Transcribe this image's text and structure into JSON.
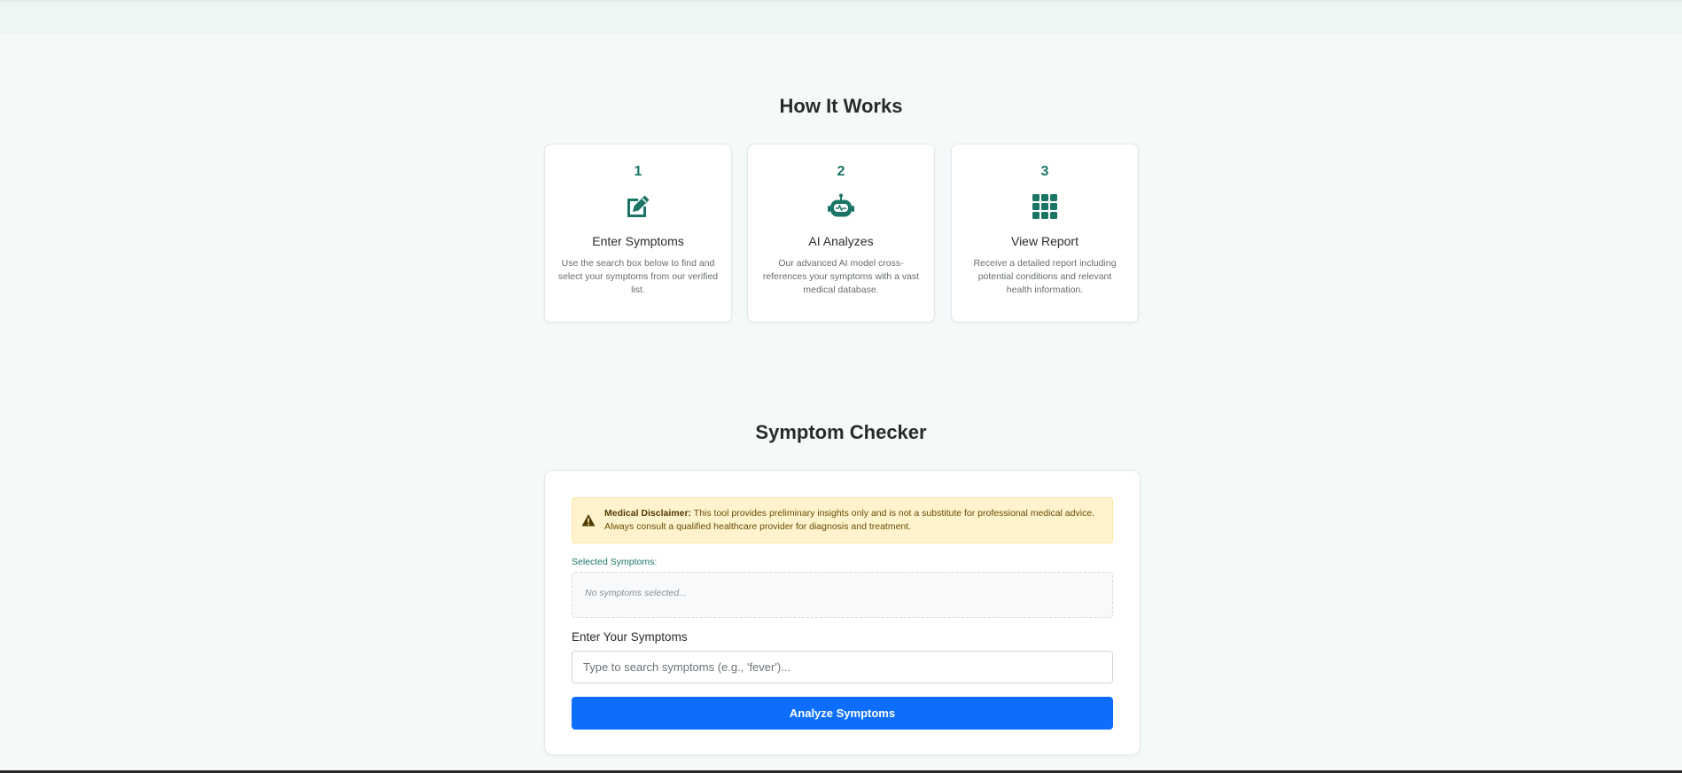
{
  "colors": {
    "accent": "#1a7566",
    "primary_button": "#0d6efd",
    "warning_bg": "#fff3cd",
    "warning_text": "#664d03"
  },
  "how_it_works": {
    "title": "How It Works",
    "steps": [
      {
        "number": "1",
        "icon": "edit-icon",
        "title": "Enter Symptoms",
        "description": "Use the search box below to find and select your symptoms from our verified list."
      },
      {
        "number": "2",
        "icon": "robot-icon",
        "title": "AI Analyzes",
        "description": "Our advanced AI model cross-references your symptoms with a vast medical database."
      },
      {
        "number": "3",
        "icon": "grid-icon",
        "title": "View Report",
        "description": "Receive a detailed report including potential conditions and relevant health information."
      }
    ]
  },
  "checker": {
    "title": "Symptom Checker",
    "disclaimer": {
      "icon": "warning-icon",
      "label": "Medical Disclaimer:",
      "text": " This tool provides preliminary insights only and is not a substitute for professional medical advice. Always consult a qualified healthcare provider for diagnosis and treatment."
    },
    "selected_label": "Selected Symptoms:",
    "selected_empty": "No symptoms selected...",
    "input_label": "Enter Your Symptoms",
    "input_placeholder": "Type to search symptoms (e.g., 'fever')...",
    "input_value": "",
    "button_label": "Analyze Symptoms"
  }
}
